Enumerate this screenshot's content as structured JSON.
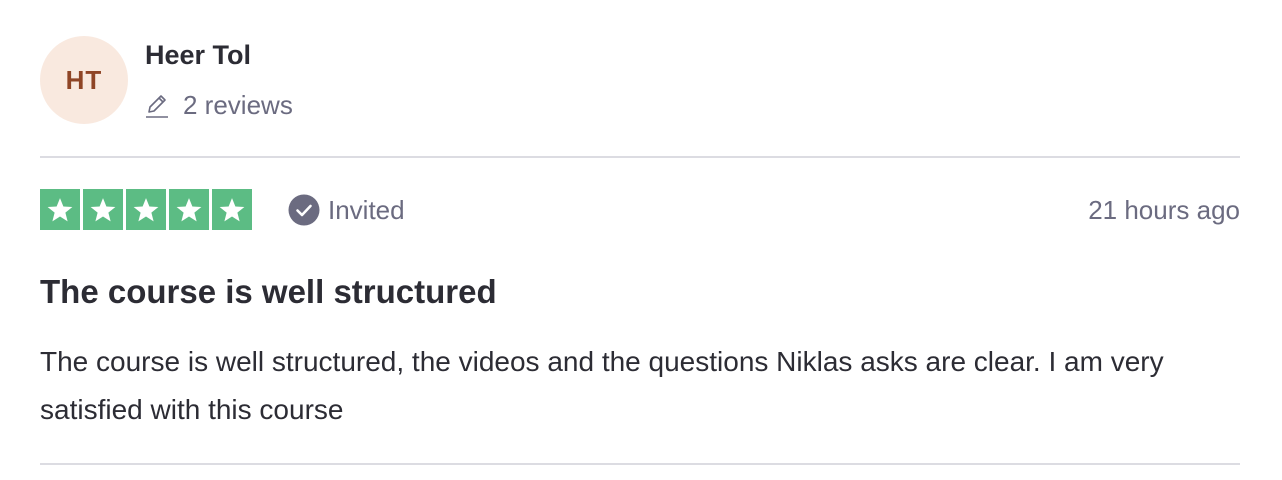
{
  "consumer": {
    "initials": "HT",
    "name": "Heer Tol",
    "reviews_count": "2 reviews"
  },
  "rating": {
    "stars": 5,
    "max_stars": 5,
    "star_color": "#5cbc84"
  },
  "verification": {
    "label": "Invited",
    "icon": "check-circle-icon"
  },
  "review": {
    "date": "21 hours ago",
    "title": "The course is well structured",
    "body": "The course is well structured, the videos and the questions Niklas asks are clear. I am very satisfied with this course"
  },
  "colors": {
    "avatar_bg": "#f9e9df",
    "avatar_text": "#8f4526",
    "text_primary": "#2c2c34",
    "text_secondary": "#6b6b80",
    "divider": "#dcdce2"
  }
}
